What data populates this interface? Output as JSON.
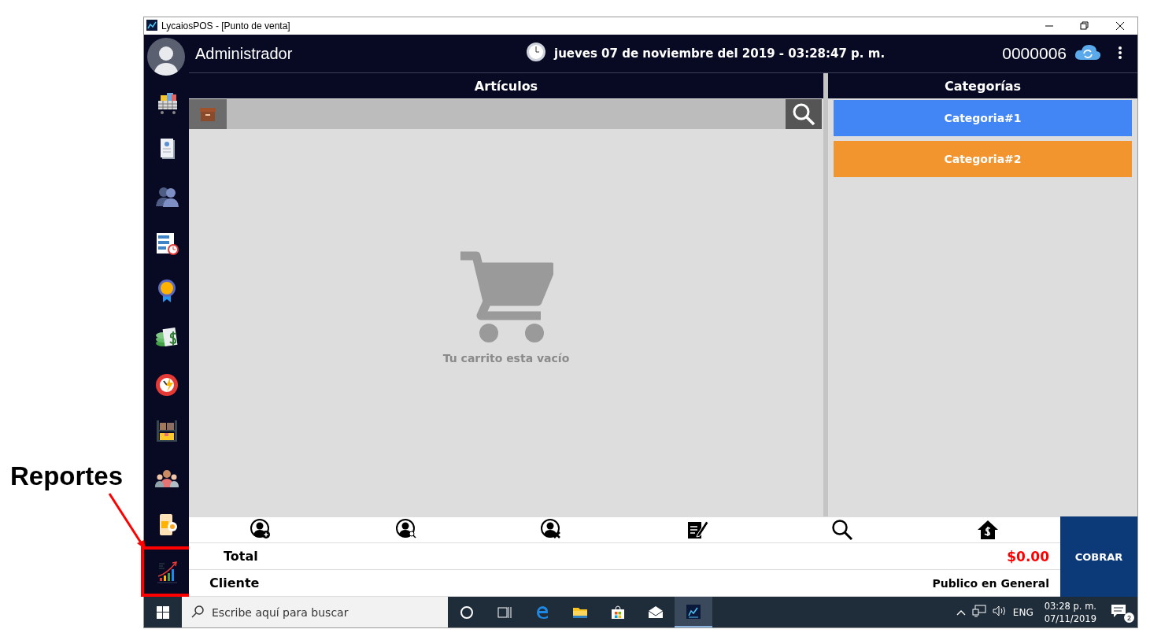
{
  "window": {
    "title": "LycaiosPOS - [Punto de venta]"
  },
  "header": {
    "user": "Administrador",
    "datetime": "jueves 07 de noviembre del 2019 - 03:28:47 p. m.",
    "ticket_number": "0000006"
  },
  "sidebar": {
    "items": [
      {
        "kind": "cart",
        "highlighted": false
      },
      {
        "kind": "receipt",
        "highlighted": false
      },
      {
        "kind": "users",
        "highlighted": false
      },
      {
        "kind": "schedule",
        "highlighted": false
      },
      {
        "kind": "top",
        "highlighted": false
      },
      {
        "kind": "money",
        "highlighted": false
      },
      {
        "kind": "stopwatch",
        "highlighted": false
      },
      {
        "kind": "warehouse",
        "highlighted": false
      },
      {
        "kind": "team",
        "highlighted": false
      },
      {
        "kind": "phone",
        "highlighted": false
      },
      {
        "kind": "chart",
        "highlighted": true
      }
    ]
  },
  "articles": {
    "title": "Artículos",
    "empty_message": "Tu carrito esta vacío"
  },
  "categories": {
    "title": "Categorías",
    "items": [
      {
        "label": "Categoria#1",
        "color": "#4285f4"
      },
      {
        "label": "Categoria#2",
        "color": "#f2952f"
      }
    ]
  },
  "actions": [
    {
      "kind": "add-client"
    },
    {
      "kind": "find-client"
    },
    {
      "kind": "remove-client"
    },
    {
      "kind": "note"
    },
    {
      "kind": "search"
    },
    {
      "kind": "cash-home"
    }
  ],
  "summary": {
    "total_label": "Total",
    "total": "$0.00",
    "client_label": "Cliente",
    "client": "Publico en General"
  },
  "charge_button": "COBRAR",
  "taskbar": {
    "search_placeholder": "Escribe aquí para buscar",
    "language": "ENG",
    "time": "03:28 p. m.",
    "date": "07/11/2019",
    "notifications": "2"
  },
  "callout": {
    "label": "Reportes"
  }
}
